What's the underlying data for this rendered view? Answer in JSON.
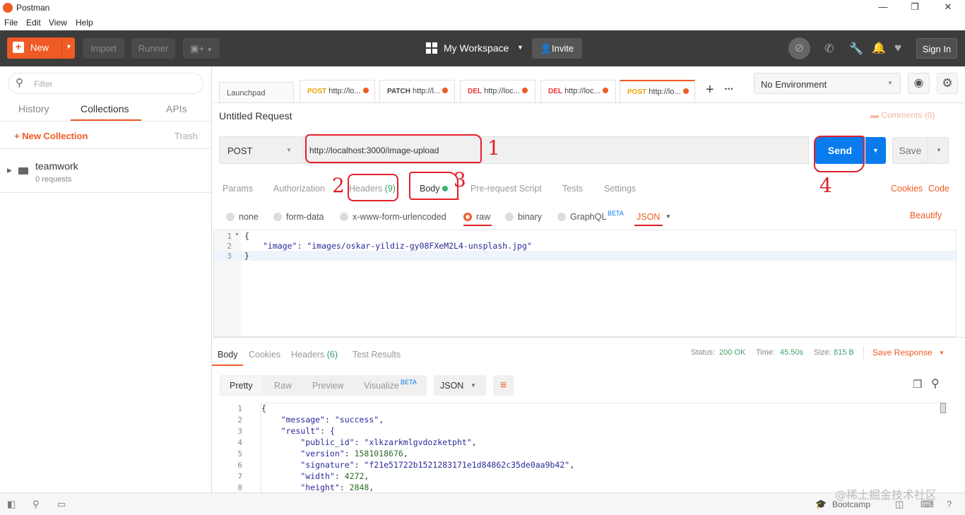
{
  "window": {
    "title": "Postman",
    "minimize": "—",
    "restore": "❐",
    "close": "✕"
  },
  "menu": [
    "File",
    "Edit",
    "View",
    "Help"
  ],
  "header": {
    "new_label": "New",
    "import_label": "Import",
    "runner_label": "Runner",
    "workspace_label": "My Workspace",
    "invite_label": "Invite",
    "signin_label": "Sign In"
  },
  "sidebar": {
    "filter_placeholder": "Filter",
    "tabs": [
      "History",
      "Collections",
      "APIs"
    ],
    "new_collection": "+ New Collection",
    "trash": "Trash",
    "collection_name": "teamwork",
    "collection_count": "0 requests"
  },
  "tabs": {
    "launchpad": "Launchpad",
    "items": [
      {
        "method": "POST",
        "url": "http://lo..."
      },
      {
        "method": "PATCH",
        "url": "http://l..."
      },
      {
        "method": "DEL",
        "url": "http://loc..."
      },
      {
        "method": "DEL",
        "url": "http://loc..."
      },
      {
        "method": "POST",
        "url": "http://lo..."
      }
    ],
    "add": "+",
    "more": "•••"
  },
  "env": {
    "selected": "No Environment"
  },
  "request": {
    "title": "Untitled Request",
    "comments": "Comments (0)",
    "method": "POST",
    "url": "http://localhost:3000/image-upload",
    "send": "Send",
    "save": "Save",
    "subtabs": {
      "params": "Params",
      "authorization": "Authorization",
      "headers": "Headers",
      "headers_count": "(9)",
      "body": "Body",
      "prerequest": "Pre-request Script",
      "tests": "Tests",
      "settings": "Settings",
      "cookies": "Cookies",
      "code": "Code"
    },
    "body_types": {
      "none": "none",
      "formdata": "form-data",
      "urlencoded": "x-www-form-urlencoded",
      "raw": "raw",
      "binary": "binary",
      "graphql": "GraphQL",
      "beta": "BETA",
      "json": "JSON",
      "beautify": "Beautify"
    },
    "body_lines": {
      "l1": "{",
      "l2_key": "\"image\"",
      "l2_sep": ": ",
      "l2_val": "\"images/oskar-yildiz-gy08FXeM2L4-unsplash.jpg\"",
      "l3": "}"
    }
  },
  "response": {
    "tabs": {
      "body": "Body",
      "cookies": "Cookies",
      "headers": "Headers",
      "headers_count": "(6)",
      "tests": "Test Results"
    },
    "status_label": "Status:",
    "status_value": "200 OK",
    "time_label": "Time:",
    "time_value": "45.50s",
    "size_label": "Size:",
    "size_value": "815 B",
    "save_response": "Save Response",
    "views": {
      "pretty": "Pretty",
      "raw": "Raw",
      "preview": "Preview",
      "visualize": "Visualize",
      "beta": "BETA",
      "json": "JSON"
    },
    "lines": [
      {
        "n": "1",
        "text": "{"
      },
      {
        "n": "2",
        "key": "\"message\"",
        "val": "\"success\"",
        "indent": "    ",
        "trail": ","
      },
      {
        "n": "3",
        "key": "\"result\"",
        "val": "{",
        "indent": "    ",
        "trail": ""
      },
      {
        "n": "4",
        "key": "\"public_id\"",
        "val": "\"xlkzarkmlgvdozketpht\"",
        "indent": "        ",
        "trail": ","
      },
      {
        "n": "5",
        "key": "\"version\"",
        "val": "1581018676",
        "indent": "        ",
        "trail": ","
      },
      {
        "n": "6",
        "key": "\"signature\"",
        "val": "\"f21e51722b1521283171e1d84862c35de0aa9b42\"",
        "indent": "        ",
        "trail": ","
      },
      {
        "n": "7",
        "key": "\"width\"",
        "val": "4272",
        "indent": "        ",
        "trail": ","
      },
      {
        "n": "8",
        "key": "\"height\"",
        "val": "2848",
        "indent": "        ",
        "trail": ","
      }
    ]
  },
  "annotations": [
    "1",
    "2",
    "3",
    "4"
  ],
  "footer": {
    "bootcamp": "Bootcamp",
    "watermark": "@稀土掘金技术社区"
  }
}
